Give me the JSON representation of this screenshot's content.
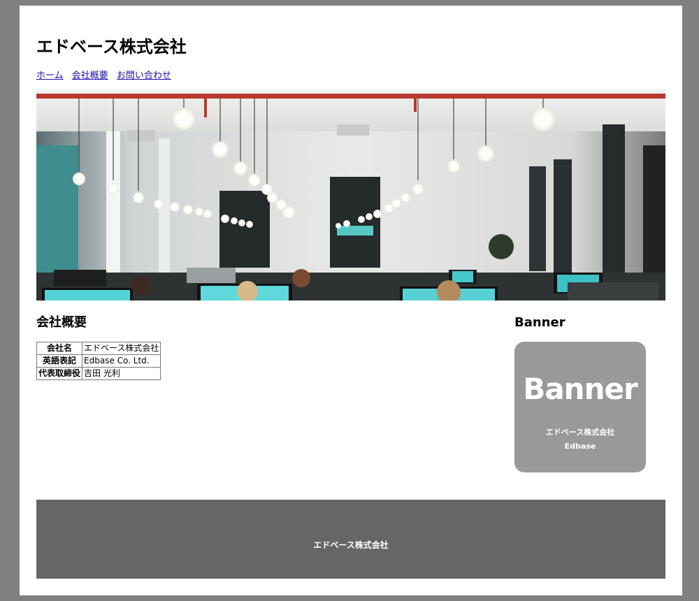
{
  "site": {
    "title": "エドベース株式会社"
  },
  "nav": {
    "items": [
      {
        "label": "ホーム"
      },
      {
        "label": "会社概要"
      },
      {
        "label": "お問い合わせ"
      }
    ]
  },
  "hero": {
    "image": "office-interior-photo"
  },
  "main": {
    "section_title": "会社概要",
    "company_table": [
      {
        "label": "会社名",
        "value": "エドベース株式会社"
      },
      {
        "label": "英語表記",
        "value": "Edbase Co. Ltd."
      },
      {
        "label": "代表取締役",
        "value": "吉田 光利"
      }
    ]
  },
  "sidebar": {
    "heading": "Banner",
    "banner": {
      "word": "Banner",
      "company": "エドベース株式会社",
      "brand": "Edbase"
    }
  },
  "footer": {
    "text": "エドベース株式会社"
  },
  "colors": {
    "outer_background": "#808080",
    "page_background": "#ffffff",
    "link": "#1a0dab",
    "banner_background": "#999999",
    "footer_background": "#666666"
  }
}
